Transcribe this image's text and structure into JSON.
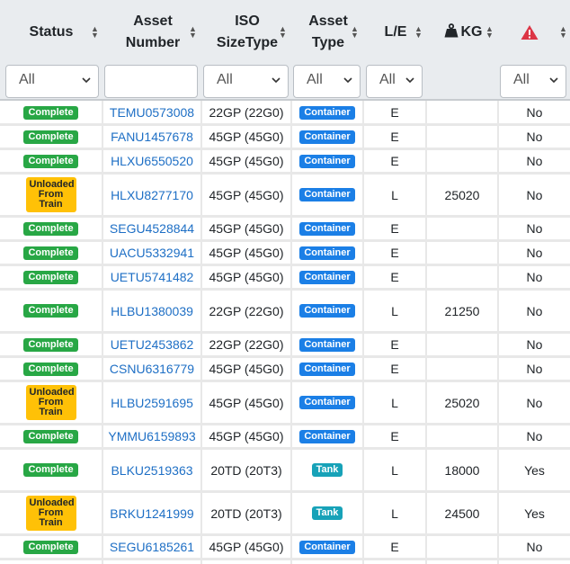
{
  "header": {
    "status": "Status",
    "asset_number_line1": "Asset",
    "asset_number_line2": "Number",
    "iso_line1": "ISO",
    "iso_line2": "SizeType",
    "asset_type_line1": "Asset",
    "asset_type_line2": "Type",
    "le": "L/E",
    "kg": "KG",
    "hazard_icon": "warning-triangle-icon",
    "weight_icon": "weight-icon"
  },
  "filters": {
    "status": "All",
    "asset_number": "",
    "iso": "All",
    "asset_type": "All",
    "le": "All",
    "hazard": "All"
  },
  "rows": [
    {
      "status": "Complete",
      "asset": "TEMU0573008",
      "iso": "22GP (22G0)",
      "type": "Container",
      "le": "E",
      "kg": "",
      "haz": "No"
    },
    {
      "status": "Complete",
      "asset": "FANU1457678",
      "iso": "45GP (45G0)",
      "type": "Container",
      "le": "E",
      "kg": "",
      "haz": "No"
    },
    {
      "status": "Complete",
      "asset": "HLXU6550520",
      "iso": "45GP (45G0)",
      "type": "Container",
      "le": "E",
      "kg": "",
      "haz": "No"
    },
    {
      "status": "Unloaded From Train",
      "asset": "HLXU8277170",
      "iso": "45GP (45G0)",
      "type": "Container",
      "le": "L",
      "kg": "25020",
      "haz": "No"
    },
    {
      "status": "Complete",
      "asset": "SEGU4528844",
      "iso": "45GP (45G0)",
      "type": "Container",
      "le": "E",
      "kg": "",
      "haz": "No"
    },
    {
      "status": "Complete",
      "asset": "UACU5332941",
      "iso": "45GP (45G0)",
      "type": "Container",
      "le": "E",
      "kg": "",
      "haz": "No"
    },
    {
      "status": "Complete",
      "asset": "UETU5741482",
      "iso": "45GP (45G0)",
      "type": "Container",
      "le": "E",
      "kg": "",
      "haz": "No"
    },
    {
      "status": "Complete",
      "asset": "HLBU1380039",
      "iso": "22GP (22G0)",
      "type": "Container",
      "le": "L",
      "kg": "21250",
      "haz": "No"
    },
    {
      "status": "Complete",
      "asset": "UETU2453862",
      "iso": "22GP (22G0)",
      "type": "Container",
      "le": "E",
      "kg": "",
      "haz": "No"
    },
    {
      "status": "Complete",
      "asset": "CSNU6316779",
      "iso": "45GP (45G0)",
      "type": "Container",
      "le": "E",
      "kg": "",
      "haz": "No"
    },
    {
      "status": "Unloaded From Train",
      "asset": "HLBU2591695",
      "iso": "45GP (45G0)",
      "type": "Container",
      "le": "L",
      "kg": "25020",
      "haz": "No"
    },
    {
      "status": "Complete",
      "asset": "YMMU6159893",
      "iso": "45GP (45G0)",
      "type": "Container",
      "le": "E",
      "kg": "",
      "haz": "No"
    },
    {
      "status": "Complete",
      "asset": "BLKU2519363",
      "iso": "20TD (20T3)",
      "type": "Tank",
      "le": "L",
      "kg": "18000",
      "haz": "Yes"
    },
    {
      "status": "Unloaded From Train",
      "asset": "BRKU1241999",
      "iso": "20TD (20T3)",
      "type": "Tank",
      "le": "L",
      "kg": "24500",
      "haz": "Yes"
    },
    {
      "status": "Complete",
      "asset": "SEGU6185261",
      "iso": "45GP (45G0)",
      "type": "Container",
      "le": "E",
      "kg": "",
      "haz": "No"
    }
  ],
  "colors": {
    "complete": "#28a745",
    "unloaded": "#ffc107",
    "container": "#1b7fe6",
    "tank": "#17a2b8",
    "hazard": "#dc3545",
    "link": "#1e6fc5"
  }
}
